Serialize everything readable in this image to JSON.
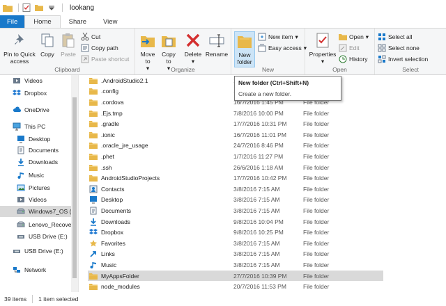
{
  "window": {
    "title": "lookang"
  },
  "tabs": [
    {
      "label": "File"
    },
    {
      "label": "Home"
    },
    {
      "label": "Share"
    },
    {
      "label": "View"
    }
  ],
  "ribbon": {
    "clipboard": {
      "label": "Clipboard",
      "pin": "Pin to Quick access",
      "copy": "Copy",
      "paste": "Paste",
      "cut": "Cut",
      "copy_path": "Copy path",
      "paste_shortcut": "Paste shortcut"
    },
    "organize": {
      "label": "Organize",
      "move_to": "Move to",
      "copy_to": "Copy to",
      "delete": "Delete",
      "rename": "Rename"
    },
    "new": {
      "label": "New",
      "new_folder": "New folder",
      "new_item": "New item",
      "easy_access": "Easy access"
    },
    "open": {
      "label": "Open",
      "properties": "Properties",
      "open": "Open",
      "edit": "Edit",
      "history": "History"
    },
    "select": {
      "label": "Select",
      "select_all": "Select all",
      "select_none": "Select none",
      "invert": "Invert selection"
    }
  },
  "tooltip": {
    "title": "New folder (Ctrl+Shift+N)",
    "desc": "Create a new folder."
  },
  "nav": {
    "items": [
      {
        "label": "Videos",
        "icon": "video-icon"
      },
      {
        "label": "Dropbox",
        "icon": "dropbox-icon"
      },
      {
        "label": "OneDrive",
        "icon": "cloud-icon"
      },
      {
        "label": "This PC",
        "icon": "computer-icon"
      },
      {
        "label": "Desktop",
        "icon": "desktop-icon"
      },
      {
        "label": "Documents",
        "icon": "documents-icon"
      },
      {
        "label": "Downloads",
        "icon": "download-icon"
      },
      {
        "label": "Music",
        "icon": "music-icon"
      },
      {
        "label": "Pictures",
        "icon": "pictures-icon"
      },
      {
        "label": "Videos",
        "icon": "video-icon"
      },
      {
        "label": "Windows7_OS (C",
        "icon": "drive-icon"
      },
      {
        "label": "Lenovo_Recover",
        "icon": "drive-icon"
      },
      {
        "label": "USB Drive (E:)",
        "icon": "usb-icon"
      },
      {
        "label": "USB Drive (E:)",
        "icon": "usb-icon"
      },
      {
        "label": "Network",
        "icon": "network-icon"
      }
    ]
  },
  "files": [
    {
      "name": ".AndroidStudio2.1",
      "date": "17/",
      "type": "",
      "icon": "folder-icon"
    },
    {
      "name": ".config",
      "date": "16/",
      "type": "",
      "icon": "folder-icon"
    },
    {
      "name": ".cordova",
      "date": "16/7/2016 1:45 PM",
      "type": "File folder",
      "icon": "folder-icon"
    },
    {
      "name": ".Ejs.tmp",
      "date": "7/8/2016 10:00 PM",
      "type": "File folder",
      "icon": "folder-icon"
    },
    {
      "name": ".gradle",
      "date": "17/7/2016 10:31 PM",
      "type": "File folder",
      "icon": "folder-icon"
    },
    {
      "name": ".ionic",
      "date": "16/7/2016 11:01 PM",
      "type": "File folder",
      "icon": "folder-icon"
    },
    {
      "name": ".oracle_jre_usage",
      "date": "24/7/2016 8:46 PM",
      "type": "File folder",
      "icon": "folder-icon"
    },
    {
      "name": ".phet",
      "date": "1/7/2016 11:27 PM",
      "type": "File folder",
      "icon": "folder-icon"
    },
    {
      "name": ".ssh",
      "date": "26/6/2016 1:18 AM",
      "type": "File folder",
      "icon": "folder-icon"
    },
    {
      "name": "AndroidStudioProjects",
      "date": "17/7/2016 10:42 PM",
      "type": "File folder",
      "icon": "folder-icon"
    },
    {
      "name": "Contacts",
      "date": "3/8/2016 7:15 AM",
      "type": "File folder",
      "icon": "contacts-icon"
    },
    {
      "name": "Desktop",
      "date": "3/8/2016 7:15 AM",
      "type": "File folder",
      "icon": "desktop-icon"
    },
    {
      "name": "Documents",
      "date": "3/8/2016 7:15 AM",
      "type": "File folder",
      "icon": "documents-icon"
    },
    {
      "name": "Downloads",
      "date": "9/8/2016 10:04 PM",
      "type": "File folder",
      "icon": "download-icon"
    },
    {
      "name": "Dropbox",
      "date": "9/8/2016 10:25 PM",
      "type": "File folder",
      "icon": "dropbox-icon"
    },
    {
      "name": "Favorites",
      "date": "3/8/2016 7:15 AM",
      "type": "File folder",
      "icon": "star-icon"
    },
    {
      "name": "Links",
      "date": "3/8/2016 7:15 AM",
      "type": "File folder",
      "icon": "link-icon"
    },
    {
      "name": "Music",
      "date": "3/8/2016 7:15 AM",
      "type": "File folder",
      "icon": "music-icon"
    },
    {
      "name": "MyAppsFolder",
      "date": "27/7/2016 10:39 PM",
      "type": "File folder",
      "icon": "folder-icon",
      "selected": true
    },
    {
      "name": "node_modules",
      "date": "20/7/2016 11:53 PM",
      "type": "File folder",
      "icon": "folder-icon"
    }
  ],
  "status": {
    "count": "39 items",
    "selected": "1 item selected"
  },
  "colors": {
    "accent": "#1979ca",
    "folder": "#e8b84a",
    "selection": "#d9d9d9",
    "hover": "#cce4f7"
  }
}
